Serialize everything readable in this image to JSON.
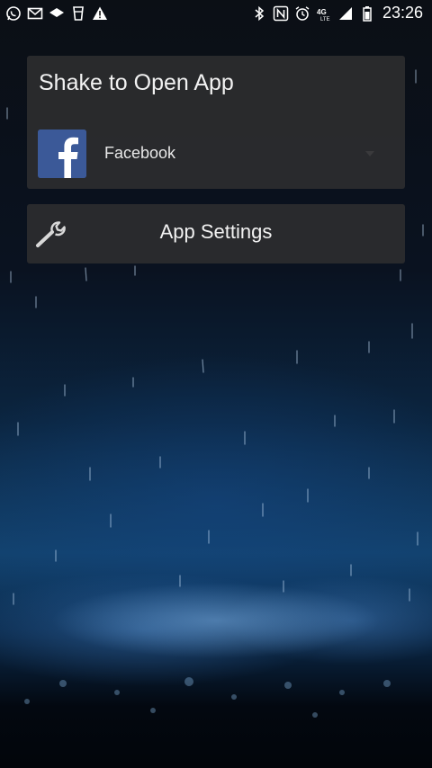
{
  "status_bar": {
    "time": "23:26",
    "left_icons": [
      "whatsapp-icon",
      "gmail-icon",
      "wifi-icon",
      "glass-icon",
      "warning-icon"
    ],
    "right_icons": [
      "bluetooth-icon",
      "nfc-icon",
      "alarm-icon",
      "lte-icon",
      "signal-icon",
      "battery-icon"
    ]
  },
  "shake_card": {
    "title": "Shake to Open App",
    "selected_app": {
      "name": "Facebook",
      "icon": "facebook-icon",
      "icon_color": "#3b5998"
    }
  },
  "settings_card": {
    "label": "App Settings",
    "icon": "wrench-icon"
  },
  "colors": {
    "card_background": "#2c2c2e",
    "text": "#f2f2f2"
  }
}
